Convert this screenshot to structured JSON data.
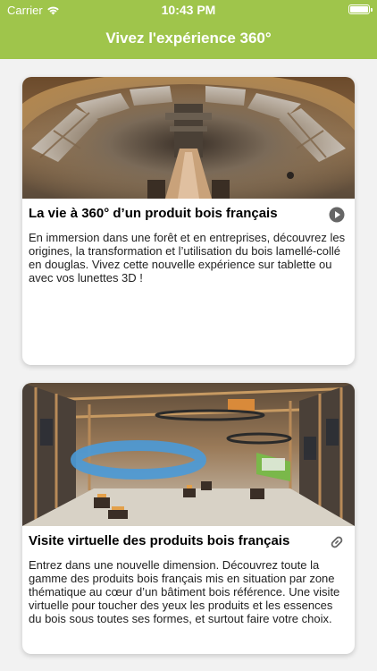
{
  "status_bar": {
    "carrier": "Carrier",
    "time": "10:43 PM"
  },
  "nav": {
    "title": "Vivez l'expérience 360°",
    "color": "#9fc54b"
  },
  "cards": [
    {
      "title": "La vie à 360° d’un produit bois français",
      "action_icon": "play-icon",
      "description": "En immersion dans une forêt et en entreprises, découvrez les origines, la transformation et l’utilisation du bois lamellé-collé en douglas. Vivez cette nouvelle expérience sur tablette ou avec vos lunettes 3D !"
    },
    {
      "title": "Visite virtuelle des produits bois français",
      "action_icon": "link-icon",
      "description": "Entrez dans une nouvelle dimension. Découvrez toute la gamme des produits bois français mis en situation par zone thématique au cœur d’un bâtiment bois référence. Une visite virtuelle pour toucher des yeux les produits et les essences du bois sous toutes ses formes, et surtout faire votre choix."
    }
  ]
}
